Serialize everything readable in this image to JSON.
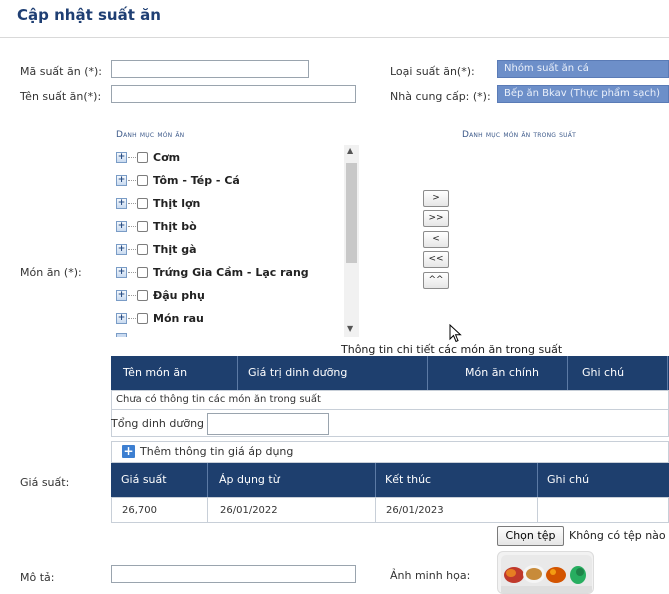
{
  "page": {
    "title": "Cập nhật suất ăn"
  },
  "form": {
    "ma_suat_an_label": "Mã suất ăn (*):",
    "ten_suat_an_label": "Tên suất ăn(*):",
    "loai_suat_an_label": "Loại suất ăn(*):",
    "loai_suat_an_value": "Nhóm suất ăn cá",
    "nha_cung_cap_label": "Nhà cung cấp: (*):",
    "nha_cung_cap_value": "Bếp ăn Bkav (Thực phẩm sạch)",
    "mon_an_label": "Món ăn (*):",
    "gia_suat_label": "Giá suất:",
    "mo_ta_label": "Mô tả:",
    "anh_minh_hoa_label": "Ảnh minh họa:"
  },
  "menu": {
    "catalog_heading": "Danh mục món ăn",
    "selected_heading": "Danh mục món ăn trong suất",
    "items": [
      "Cơm",
      "Tôm - Tép - Cá",
      "Thịt lợn",
      "Thịt bò",
      "Thịt gà",
      "Trứng Gia Cầm - Lạc rang",
      "Đậu phụ",
      "Món rau"
    ],
    "move_buttons": [
      ">",
      ">>",
      "<",
      "<<",
      "^^"
    ]
  },
  "detail_table": {
    "caption": "Thông tin chi tiết các món ăn trong suất",
    "columns": [
      "Tên món ăn",
      "Giá trị dinh dưỡng",
      "Món ăn chính",
      "Ghi chú"
    ],
    "empty_text": "Chưa có thông tin các món ăn trong suất",
    "tong_dinh_duong_label": "Tổng dinh dưỡng :"
  },
  "price_table": {
    "add_label": "Thêm thông tin giá áp dụng",
    "columns": [
      "Giá suất",
      "Áp dụng từ",
      "Kết thúc",
      "Ghi chú"
    ],
    "rows": [
      {
        "gia_suat": "26,700",
        "ap_dung_tu": "26/01/2022",
        "ket_thuc": "26/01/2023",
        "ghi_chu": ""
      }
    ]
  },
  "file": {
    "button_label": "Chọn tệp",
    "status": "Không có tệp nào"
  },
  "colors": {
    "accent": "#1e3f6e",
    "select_bg": "#6d8fc9",
    "title": "#1f3f73"
  }
}
